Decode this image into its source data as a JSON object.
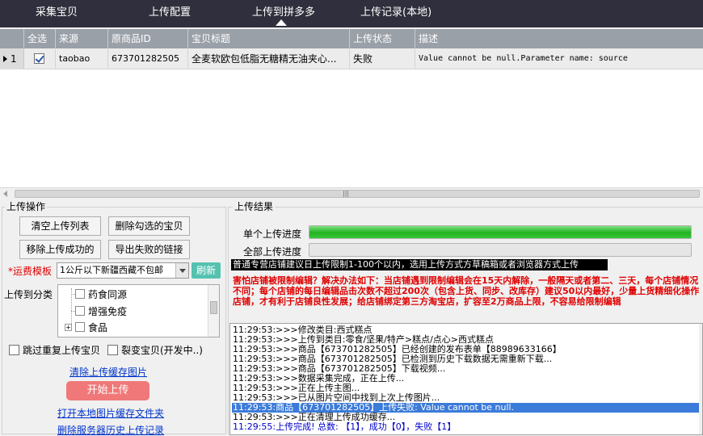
{
  "nav": {
    "tabs": [
      "采集宝贝",
      "上传配置",
      "上传到拼多多",
      "上传记录(本地)"
    ],
    "active_index": 2
  },
  "grid": {
    "columns": [
      "全选",
      "来源",
      "原商品ID",
      "宝贝标题",
      "上传状态",
      "描述"
    ],
    "rows": [
      {
        "row_number": "1",
        "checked": true,
        "source": "taobao",
        "product_id": "673701282505",
        "title": "全麦软欧包低脂无糖精无油夹心...",
        "status": "失败",
        "desc": "Value cannot be null.Parameter name: source"
      }
    ],
    "grip": "|||"
  },
  "upload_ops": {
    "title": "上传操作",
    "buttons": {
      "clear_list": "清空上传列表",
      "delete_checked": "删除勾选的宝贝",
      "remove_success": "移除上传成功的",
      "export_failed": "导出失败的链接"
    },
    "shipping_label": "*运费模板",
    "shipping_value": "1公斤以下新疆西藏不包邮",
    "refresh": "刷新",
    "category_label": "上传到分类",
    "categories": [
      "药食同源",
      "增强免疫",
      "食品"
    ],
    "skip_dup": "跳过重复上传宝贝",
    "split_sku": "裂变宝贝(开发中..)",
    "clear_cache": "清除上传缓存图片",
    "start": "开始上传",
    "open_folder": "打开本地图片缓存文件夹",
    "delete_history": "删除服务器历史上传记录"
  },
  "upload_result": {
    "title": "上传结果",
    "single_progress_label": "单个上传进度",
    "single_progress": 1.0,
    "total_progress_label": "全部上传进度",
    "total_progress": 0.0,
    "notice_black": "普通专营店铺建议日上传限制1-100个以内，选用上传方式方草稿箱或者浏览器方式上传",
    "notice_red": "害怕店铺被限制编辑？解决办法如下：当店铺遇到限制编辑会在15天内解除，一般隔天或者第二、三天，每个店铺情况不同；每个店铺的每日编辑品击次数不超过200次（包含上货、同步、改库存）建议50以内最好，少量上货精细化操作店铺，才有利于店铺良性发展；给店铺绑定第三方淘宝店，扩容至2万商品上限，不容易给限制编辑",
    "log": [
      "11:29:53:>>>修改类目:西式糕点",
      "11:29:53:>>>上传到类目:零食/坚果/特产>糕点/点心>西式糕点",
      "11:29:53:>>>商品【673701282505】已经创建的发布表单【88989633166】",
      "11:29:53:>>>商品【673701282505】已检测到历史下载数据无需重新下载...",
      "11:29:53:>>>商品【673701282505】下载视频...",
      "11:29:53:>>>数据采集完成，正在上传...",
      "11:29:53:>>>正在上传主图...",
      "11:29:53:>>>已从图片空间中找到上次上传图片...",
      "11:29:53:商品【673701282505】上传失败: Value cannot be null.",
      "11:29:53:>>>正在清理上传成功缓存...",
      "11:29:55:上传完成! 总数: 【1】，成功【0】，失败【1】"
    ]
  }
}
